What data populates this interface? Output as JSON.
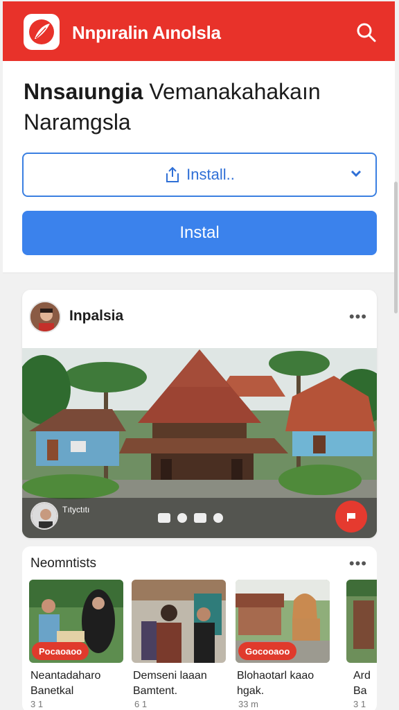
{
  "header": {
    "app_title": "Nnpıralin Aınolsla",
    "brand_color": "#e8322a"
  },
  "install_panel": {
    "title_bold": "Nnsaıungia",
    "title_rest": "Vemanakahakaın Naramgsla",
    "outline_button_label": "Install..",
    "solid_button_label": "Instal",
    "accent_color": "#3b82ec"
  },
  "post": {
    "author": "Inpalsia",
    "more_label": "•••",
    "video_author": "Tıtyctıtı"
  },
  "section": {
    "title": "Neomntists",
    "more_label": "•••",
    "items": [
      {
        "badge": "Pocaoaoo",
        "title_line1": "Neantadaharo",
        "title_line2": "Banetkal",
        "meta": "3 1"
      },
      {
        "badge": "",
        "title_line1": "Demseni laaan",
        "title_line2": "Bamtent.",
        "meta": "6 1"
      },
      {
        "badge": "Gocooaoo",
        "title_line1": "Blohaotarl kaao",
        "title_line2": "hgak.",
        "meta": "33 m"
      },
      {
        "badge": "",
        "title_line1": "Ard",
        "title_line2": "Ba",
        "meta": "3 1"
      }
    ]
  }
}
